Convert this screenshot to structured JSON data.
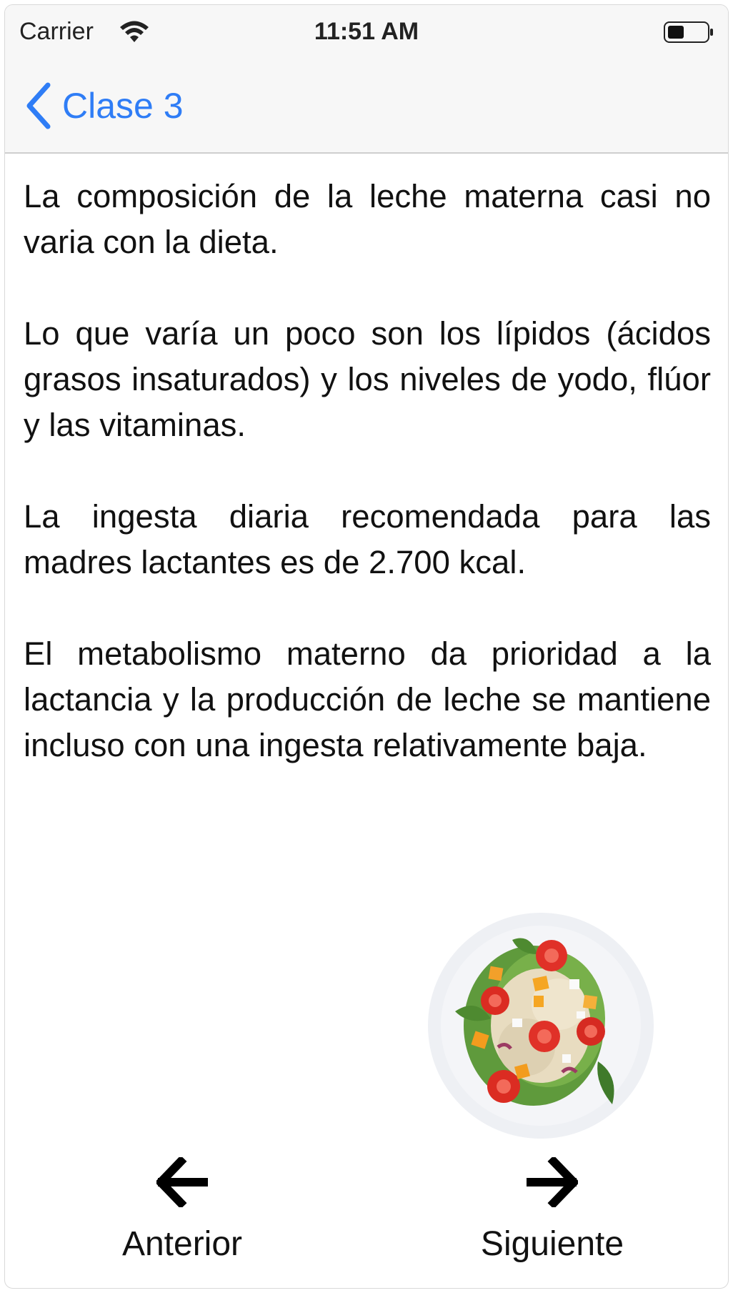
{
  "status_bar": {
    "carrier": "Carrier",
    "time": "11:51 AM",
    "wifi_icon": "wifi-icon",
    "battery_icon": "battery-icon"
  },
  "nav_bar": {
    "back_label": "Clase 3",
    "back_icon": "chevron-left-icon",
    "accent_color": "#2f7df6"
  },
  "content": {
    "paragraphs": [
      "La composición de la leche materna casi no varia con la dieta.",
      "Lo que varía un poco son los lípidos (ácidos grasos insaturados) y los niveles de yodo, flúor y las vitaminas.",
      "La ingesta diaria recomendada para las madres lactantes es de 2.700 kcal.",
      "El metabolismo materno da prioridad a la lactancia y la producción de leche se mantiene incluso con una ingesta relativamente baja."
    ],
    "image": "salad-plate-image"
  },
  "footer": {
    "prev_label": "Anterior",
    "prev_icon": "arrow-left-icon",
    "next_label": "Siguiente",
    "next_icon": "arrow-right-icon"
  }
}
